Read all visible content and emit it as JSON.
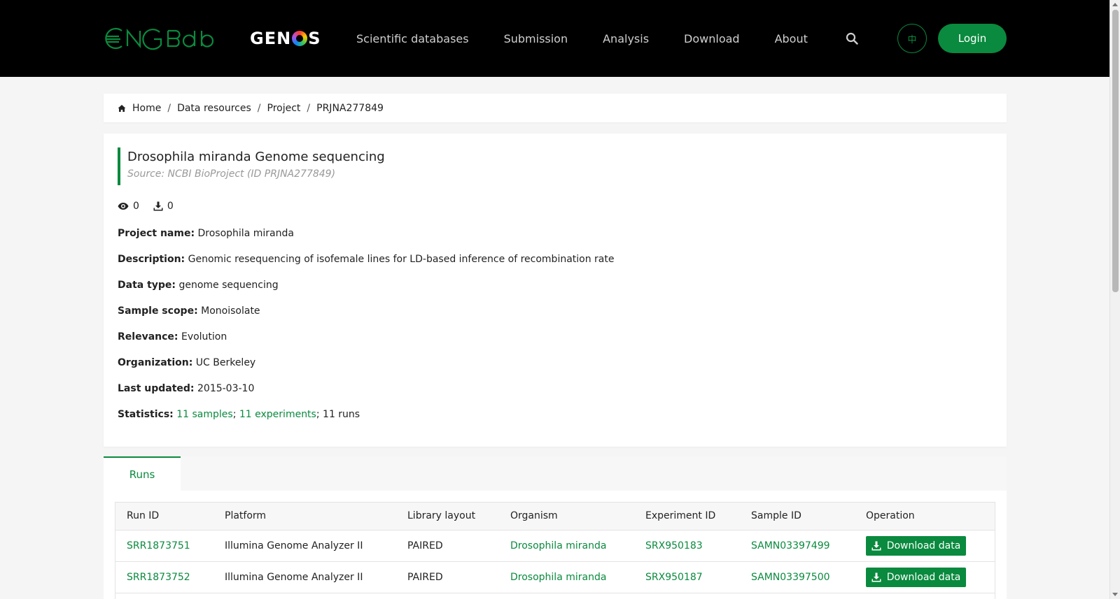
{
  "header": {
    "logo_cngb": "CNGBdb",
    "logo_genos_pre": "GEN",
    "logo_genos_post": "S",
    "nav": [
      "Scientific databases",
      "Submission",
      "Analysis",
      "Download",
      "About"
    ],
    "lang_label": "中",
    "login_label": "Login"
  },
  "breadcrumb": {
    "items": [
      "Home",
      "Data resources",
      "Project",
      "PRJNA277849"
    ],
    "separator": "/"
  },
  "project": {
    "title": "Drosophila miranda Genome sequencing",
    "source": "Source: NCBI BioProject (ID PRJNA277849)",
    "views": "0",
    "downloads": "0",
    "fields": {
      "project_name_label": "Project name:",
      "project_name": "Drosophila miranda",
      "description_label": "Description:",
      "description": "Genomic resequencing of isofemale lines for LD-based inference of recombination rate",
      "data_type_label": "Data type:",
      "data_type": "genome sequencing",
      "sample_scope_label": "Sample scope:",
      "sample_scope": "Monoisolate",
      "relevance_label": "Relevance:",
      "relevance": "Evolution",
      "organization_label": "Organization:",
      "organization": "UC Berkeley",
      "last_updated_label": "Last updated:",
      "last_updated": "2015-03-10",
      "statistics_label": "Statistics:",
      "stat_samples": "11 samples",
      "stat_experiments": "11 experiments",
      "stat_runs": "11 runs",
      "stat_sep": "; "
    }
  },
  "runs": {
    "tab_label": "Runs",
    "columns": [
      "Run ID",
      "Platform",
      "Library layout",
      "Organism",
      "Experiment ID",
      "Sample ID",
      "Operation"
    ],
    "rows": [
      {
        "run_id": "SRR1873751",
        "platform": "Illumina Genome Analyzer II",
        "layout": "PAIRED",
        "organism": "Drosophila miranda",
        "experiment_id": "SRX950183",
        "sample_id": "SAMN03397499",
        "operation": "Download data"
      },
      {
        "run_id": "SRR1873752",
        "platform": "Illumina Genome Analyzer II",
        "layout": "PAIRED",
        "organism": "Drosophila miranda",
        "experiment_id": "SRX950187",
        "sample_id": "SAMN03397500",
        "operation": "Download data"
      }
    ]
  },
  "colors": {
    "brand_green": "#0a8a3e",
    "header_bg": "#000000"
  }
}
